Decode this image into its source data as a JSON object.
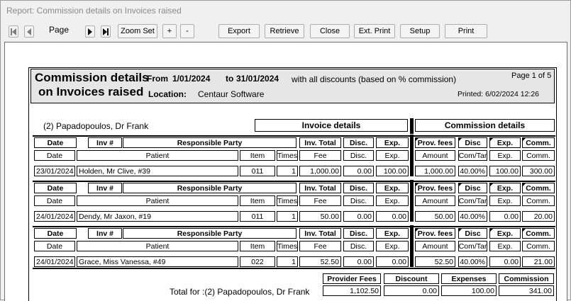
{
  "window": {
    "title": "Report: Commission details on Invoices raised"
  },
  "toolbar": {
    "page_label": "Page",
    "zoom_set": "Zoom Set",
    "zoom_in": "+",
    "zoom_out": "-",
    "export": "Export",
    "retrieve": "Retrieve",
    "close": "Close",
    "ext_print": "Ext. Print",
    "setup": "Setup",
    "print": "Print"
  },
  "report": {
    "title_line1": "Commission details",
    "title_line2": "on Invoices raised",
    "from_label": "From",
    "from_date": "1/01/2024",
    "to_label": "to",
    "to_date": "31/01/2024",
    "discount_note": "with all discounts (based on % commission)",
    "location_label": "Location:",
    "location_value": "Centaur Software",
    "page_info": "Page 1 of 5",
    "printed": "Printed: 6/02/2024 12:26",
    "provider": "(2) Papadopoulos, Dr Frank",
    "section_invoice": "Invoice details",
    "section_commission": "Commission details",
    "col1": {
      "date": "Date",
      "inv": "Inv #",
      "party": "Responsible Party",
      "inv_total": "Inv. Total",
      "disc": "Disc.",
      "exp": "Exp.",
      "prov_fees": "Prov. fees",
      "disc2": "Disc",
      "exp2": "Exp.",
      "comm": "Comm."
    },
    "col2": {
      "date": "Date",
      "patient": "Patient",
      "item": "Item",
      "times": "Times",
      "fee": "Fee",
      "disc": "Disc.",
      "exp": "Exp.",
      "amount": "Amount",
      "comtar": "Com/Tar",
      "exp2": "Exp.",
      "comm": "Comm."
    },
    "rows": [
      {
        "date": "23/01/2024",
        "patient": "Holden, Mr Clive, #39",
        "item": "011",
        "times": "1",
        "fee": "1,000.00",
        "disc": "0.00",
        "exp": "100.00",
        "amount": "1,000.00",
        "comtar": "40.00%",
        "exp2": "100.00",
        "comm": "300.00"
      },
      {
        "date": "24/01/2024",
        "patient": "Dendy, Mr Jaxon, #19",
        "item": "011",
        "times": "1",
        "fee": "50.00",
        "disc": "0.00",
        "exp": "0.00",
        "amount": "50.00",
        "comtar": "40.00%",
        "exp2": "0.00",
        "comm": "20.00"
      },
      {
        "date": "24/01/2024",
        "patient": "Grace, Miss Vanessa, #49",
        "item": "022",
        "times": "1",
        "fee": "52.50",
        "disc": "0.00",
        "exp": "0.00",
        "amount": "52.50",
        "comtar": "40.00%",
        "exp2": "0.00",
        "comm": "21.00"
      }
    ],
    "totals": {
      "label": "Total for :(2) Papadopoulos, Dr Frank",
      "h_provider_fees": "Provider Fees",
      "h_discount": "Discount",
      "h_expenses": "Expenses",
      "h_commission": "Commission",
      "provider_fees": "1,102.50",
      "discount": "0.00",
      "expenses": "100.00",
      "commission": "341.00"
    }
  }
}
